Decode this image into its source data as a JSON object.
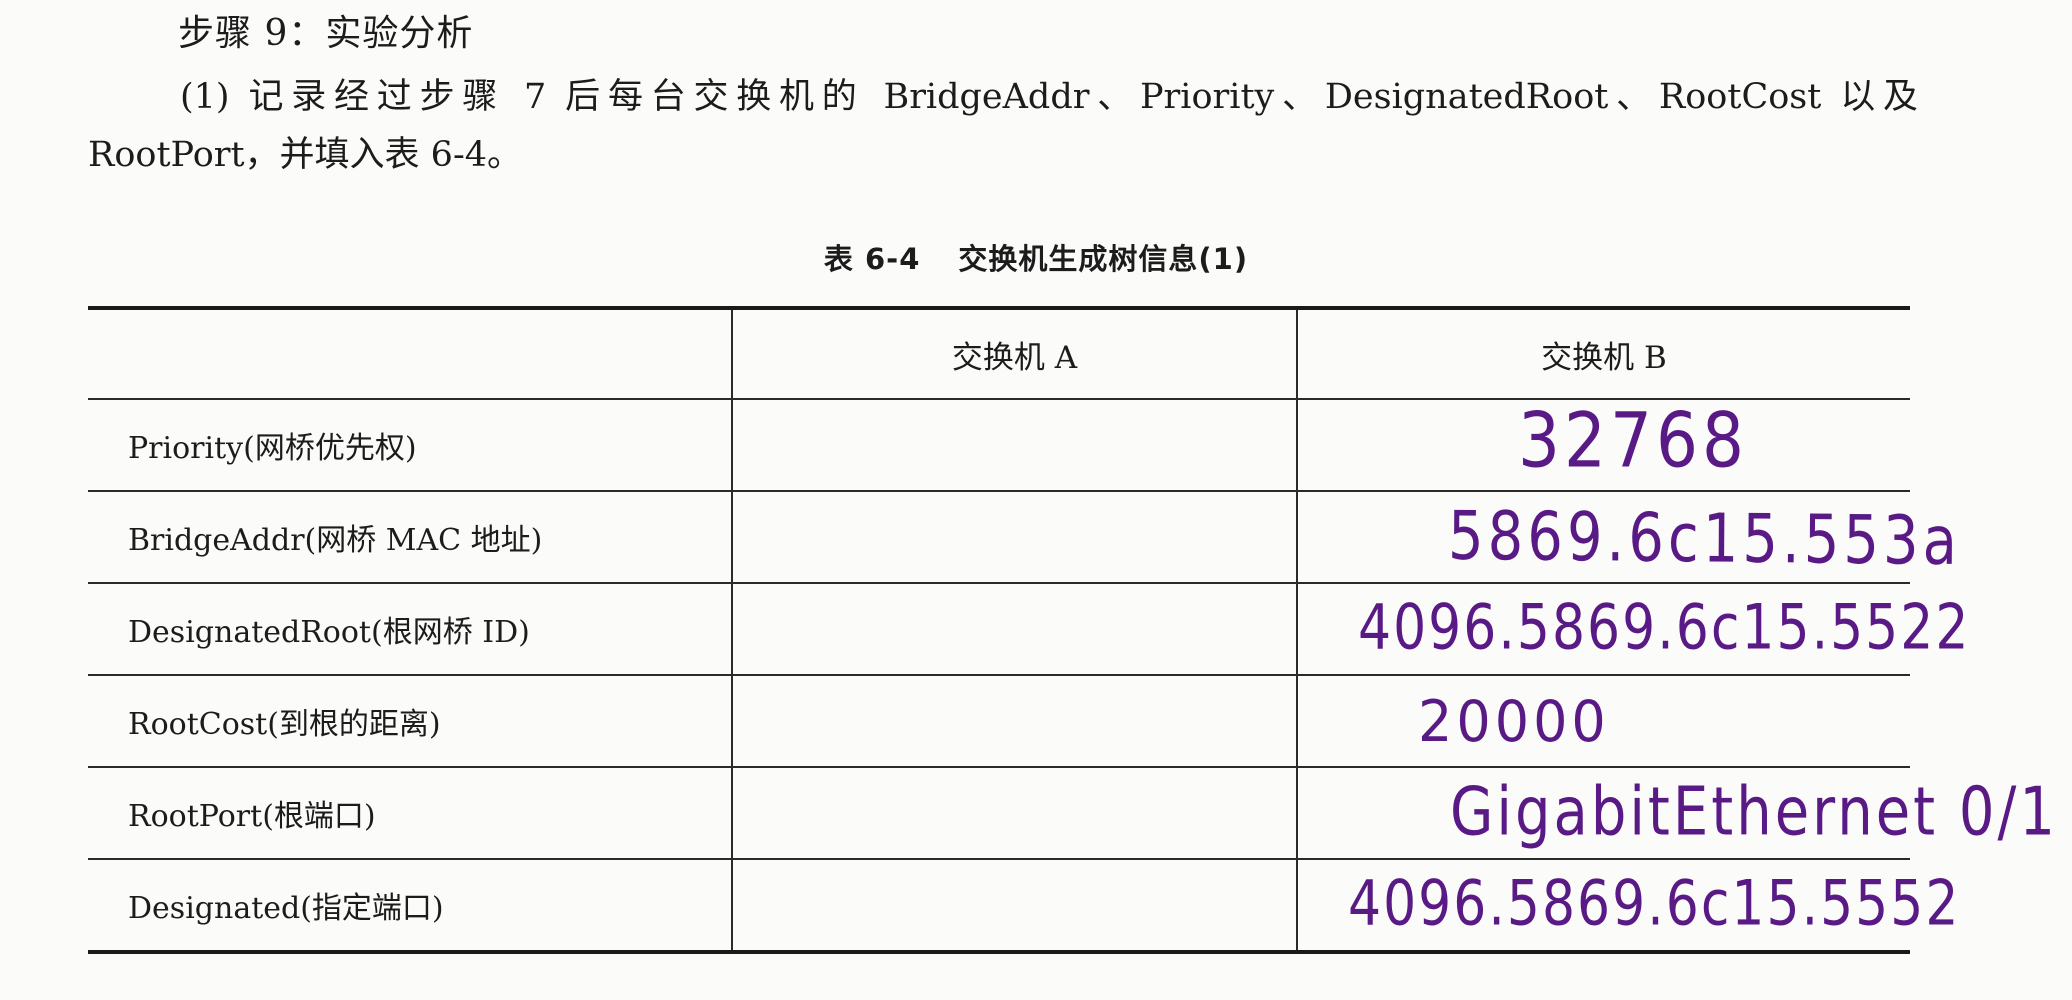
{
  "step_title": "步骤 9：实验分析",
  "paragraph": "(1) 记录经过步骤 7 后每台交换机的 BridgeAddr、Priority、DesignatedRoot、RootCost 以及 RootPort，并填入表 6-4。",
  "table": {
    "caption_number": "表 6-4",
    "caption_title": "交换机生成树信息(1)",
    "headers": [
      "",
      "交换机 A",
      "交换机 B"
    ],
    "rows": [
      {
        "label": "Priority(网桥优先权)",
        "switch_a": "",
        "switch_b": "32768"
      },
      {
        "label": "BridgeAddr(网桥 MAC 地址)",
        "switch_a": "",
        "switch_b": "5869.6c15.553a"
      },
      {
        "label": "DesignatedRoot(根网桥 ID)",
        "switch_a": "",
        "switch_b": "4096.5869.6c15.5522"
      },
      {
        "label": "RootCost(到根的距离)",
        "switch_a": "",
        "switch_b": "20000"
      },
      {
        "label": "RootPort(根端口)",
        "switch_a": "",
        "switch_b": "GigabitEthernet 0/1"
      },
      {
        "label": "Designated(指定端口)",
        "switch_a": "",
        "switch_b": "4096.5869.6c15.5552"
      }
    ]
  },
  "colors": {
    "handwriting": "#5a1a86",
    "text": "#1c1c1c",
    "rule": "#1a1a1a"
  }
}
